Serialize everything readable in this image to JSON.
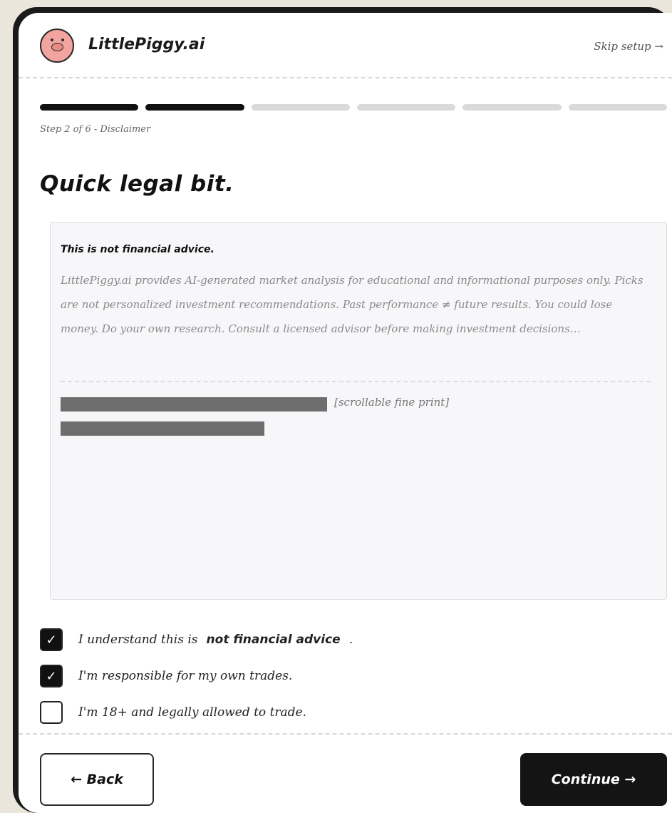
{
  "brand": {
    "name": "LittlePiggy.ai",
    "logo_icon": "pig-logo-icon"
  },
  "header": {
    "skip_label": "Skip setup →"
  },
  "progress": {
    "current_step": 2,
    "total_steps": 6,
    "label": "Step 2 of 6 - Disclaimer"
  },
  "page": {
    "title": "Quick legal bit."
  },
  "legal": {
    "heading": "This is not financial advice.",
    "body": "LittlePiggy.ai provides AI-generated market analysis for educational and informational purposes only. Picks are not personalized investment recommendations. Past performance ≠ future results. You could lose money. Do your own research. Consult a licensed advisor before making investment decisions…",
    "fine_print_note": "[scrollable fine print]"
  },
  "checks": [
    {
      "pre": "I understand this is",
      "bold": "not financial advice",
      "post": ".",
      "checked": true
    },
    {
      "pre": "I'm responsible for my own trades.",
      "bold": "",
      "post": "",
      "checked": true
    },
    {
      "pre": "I'm 18+ and legally allowed to trade.",
      "bold": "",
      "post": "",
      "checked": false
    }
  ],
  "footer": {
    "back_label": "← Back",
    "continue_label": "Continue →"
  }
}
